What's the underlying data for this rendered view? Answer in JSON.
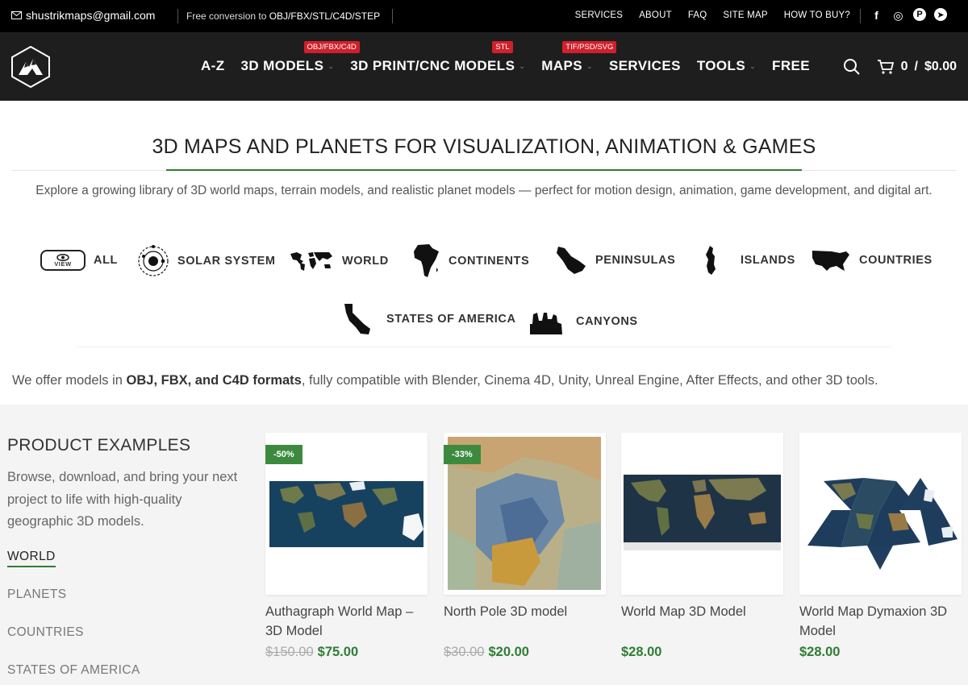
{
  "topbar": {
    "email": "shustrikmaps@gmail.com",
    "promo_prefix": "Free conversion to ",
    "promo_formats": "OBJ/FBX/STL/C4D/STEP",
    "links": [
      "SERVICES",
      "ABOUT",
      "FAQ",
      "SITE MAP",
      "HOW TO BUY?"
    ],
    "social": [
      {
        "icon": "facebook-icon",
        "glyph": "f"
      },
      {
        "icon": "instagram-icon",
        "glyph": "◎"
      },
      {
        "icon": "pinterest-icon",
        "glyph": "P"
      },
      {
        "icon": "telegram-icon",
        "glyph": "➤"
      }
    ]
  },
  "nav": {
    "items": [
      {
        "label": "A-Z",
        "badge": null,
        "dropdown": false
      },
      {
        "label": "3D MODELS",
        "badge": "OBJ/FBX/C4D",
        "dropdown": true
      },
      {
        "label": "3D PRINT/CNC MODELS",
        "badge": "STL",
        "dropdown": true
      },
      {
        "label": "MAPS",
        "badge": "TIF/PSD/SVG",
        "dropdown": true
      },
      {
        "label": "SERVICES",
        "badge": null,
        "dropdown": false
      },
      {
        "label": "TOOLS",
        "badge": null,
        "dropdown": true
      },
      {
        "label": "FREE",
        "badge": null,
        "dropdown": false
      }
    ],
    "cart_count": "0",
    "cart_sep": "/",
    "cart_total": "$0.00"
  },
  "hero": {
    "title": "3D MAPS AND PLANETS FOR VISUALIZATION, ANIMATION & GAMES",
    "description": "Explore a growing library of 3D world maps, terrain models, and realistic planet models — perfect for motion design, animation, game development, and digital art."
  },
  "categories": {
    "view_label": "VIEW",
    "items": [
      "ALL",
      "SOLAR SYSTEM",
      "WORLD",
      "CONTINENTS",
      "PENINSULAS",
      "ISLANDS",
      "COUNTRIES",
      "STATES OF AMERICA",
      "CANYONS"
    ]
  },
  "formats": {
    "prefix": "We offer models in ",
    "highlight": "OBJ, FBX, and C4D formats",
    "suffix": ", fully compatible with Blender, Cinema 4D, Unity, Unreal Engine, After Effects, and other 3D tools."
  },
  "products_section": {
    "title": "PRODUCT EXAMPLES",
    "description": "Browse, download, and bring your next project to life with high-quality geographic 3D models.",
    "filters": [
      "WORLD",
      "PLANETS",
      "COUNTRIES",
      "STATES OF AMERICA"
    ],
    "active_filter": "WORLD"
  },
  "products": [
    {
      "name": "Authagraph World Map – 3D Model",
      "discount": "-50%",
      "old_price": "$150.00",
      "price": "$75.00"
    },
    {
      "name": "North Pole 3D model",
      "discount": "-33%",
      "old_price": "$30.00",
      "price": "$20.00"
    },
    {
      "name": "World Map 3D Model",
      "discount": "",
      "old_price": "",
      "price": "$28.00"
    },
    {
      "name": "World Map Dymaxion 3D Model",
      "discount": "",
      "old_price": "",
      "price": "$28.00"
    }
  ],
  "colors": {
    "accent_green": "#2e7d32",
    "badge_red": "#d0202b",
    "header_dark": "#1e1e1e"
  }
}
